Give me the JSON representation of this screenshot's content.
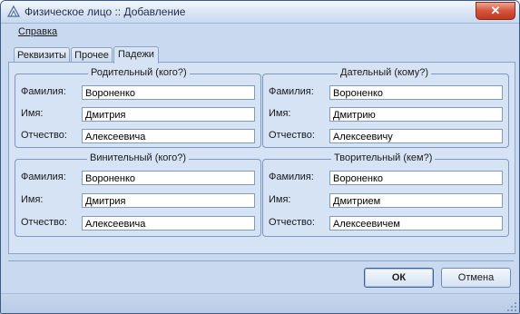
{
  "window": {
    "title": "Физическое лицо :: Добавление",
    "close_label": "✕"
  },
  "menu": {
    "help": "Справка"
  },
  "tabs": [
    {
      "label": "Реквизиты"
    },
    {
      "label": "Прочее"
    },
    {
      "label": "Падежи"
    }
  ],
  "groups": {
    "genitive": {
      "title": "Родительный (кого?)",
      "last_name_label": "Фамилия:",
      "first_name_label": "Имя:",
      "patronymic_label": "Отчество:",
      "last_name": "Вороненко",
      "first_name": "Дмитрия",
      "patronymic": "Алексеевича"
    },
    "dative": {
      "title": "Дательный (кому?)",
      "last_name_label": "Фамилия:",
      "first_name_label": "Имя:",
      "patronymic_label": "Отчество:",
      "last_name": "Вороненко",
      "first_name": "Дмитрию",
      "patronymic": "Алексеевичу"
    },
    "accusative": {
      "title": "Винительный (кого?)",
      "last_name_label": "Фамилия:",
      "first_name_label": "Имя:",
      "patronymic_label": "Отчество:",
      "last_name": "Вороненко",
      "first_name": "Дмитрия",
      "patronymic": "Алексеевича"
    },
    "instrumental": {
      "title": "Творительный (кем?)",
      "last_name_label": "Фамилия:",
      "first_name_label": "Имя:",
      "patronymic_label": "Отчество:",
      "last_name": "Вороненко",
      "first_name": "Дмитрием",
      "patronymic": "Алексеевичем"
    }
  },
  "buttons": {
    "ok": "ОК",
    "cancel": "Отмена"
  }
}
